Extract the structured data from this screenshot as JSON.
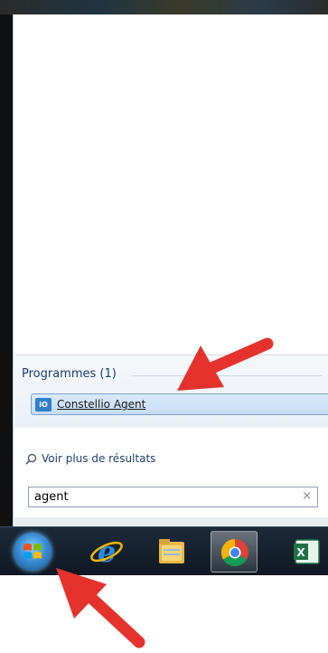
{
  "start_menu": {
    "section_header": "Programmes (1)",
    "result_item": {
      "label": "Constellio Agent",
      "icon": "constellio-app-icon",
      "icon_text": "iO"
    },
    "more_results": "Voir plus de résultats",
    "search": {
      "value": "agent",
      "clear": "×"
    }
  },
  "taskbar": {
    "items": [
      {
        "name": "start-orb",
        "icon": "windows-logo-icon"
      },
      {
        "name": "internet-explorer",
        "icon": "internet-explorer-icon"
      },
      {
        "name": "file-explorer",
        "icon": "folder-icon"
      },
      {
        "name": "chrome",
        "icon": "chrome-icon",
        "active": true
      },
      {
        "name": "excel",
        "icon": "excel-icon"
      }
    ]
  },
  "annotations": {
    "arrow_color": "#e5322d",
    "arrows": [
      {
        "name": "arrow-to-result",
        "target": "result-item"
      },
      {
        "name": "arrow-to-start",
        "target": "start-orb"
      }
    ]
  },
  "colors": {
    "selection_fill": "#c5dcf5",
    "selection_border": "#7da2ce",
    "header_text": "#1e3f6b",
    "taskbar": "#0f1822"
  }
}
